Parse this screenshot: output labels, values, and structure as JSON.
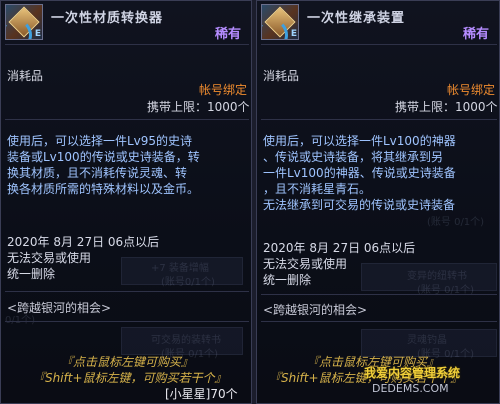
{
  "left": {
    "title": "一次性材质转换器",
    "rarity": "稀有",
    "type": "消耗品",
    "bind": "帐号绑定",
    "limit": "携带上限：1000个",
    "desc": [
      "使用后，可以选择一件Lv95的史诗",
      "装备或Lv100的传说或史诗装备，转",
      "换其材质，且不消耗传说灵魂、转",
      "换各材质所需的特殊材料以及金币。"
    ],
    "date": "2020年 8月 27日 06点以后",
    "note1": "无法交易或使用",
    "note2": "统一删除",
    "source": "<跨越银河的相会>",
    "hint1": "『点击鼠标左键可购买』",
    "hint2": "『Shift+鼠标左键，可购买若干个』",
    "count": "[小星星]70个",
    "icon": "material-converter-icon"
  },
  "right": {
    "title": "一次性继承装置",
    "rarity": "稀有",
    "type": "消耗品",
    "bind": "帐号绑定",
    "limit": "携带上限：1000个",
    "desc": [
      "使用后，可以选择一件Lv100的神器",
      "、传说或史诗装备，将其继承到另",
      "一件Lv100的神器、传说或史诗装备",
      "，且不消耗星青石。",
      "无法继承到可交易的传说或史诗装备"
    ],
    "date": "2020年 8月 27日 06点以后",
    "note1": "无法交易或使用",
    "note2": "统一删除",
    "source": "<跨越银河的相会>",
    "hint1": "『点击鼠标左键可购买』",
    "hint2": "『Shift+鼠标左键，可购买若干个』",
    "icon": "inheritance-device-icon"
  },
  "background": {
    "left_ghost": [
      "+7 装备增幅",
      "(账号0/1个)",
      "0/1个)",
      "可交易的装转书",
      "(账号 0/1个)"
    ],
    "right_ghost": [
      "(账号 0/1个)",
      "变异的纽转书",
      "(账号 0/1个)",
      "灵魂钓晶",
      "(账号 0/1个)"
    ]
  },
  "watermark": {
    "main": "我爱内容管理系统",
    "sub": "DEDEMS.COM"
  },
  "colors": {
    "rarity": "#b58cff",
    "bind": "#f08c2e",
    "desc": "#9fc4ff",
    "hint": "#d6b24a"
  }
}
